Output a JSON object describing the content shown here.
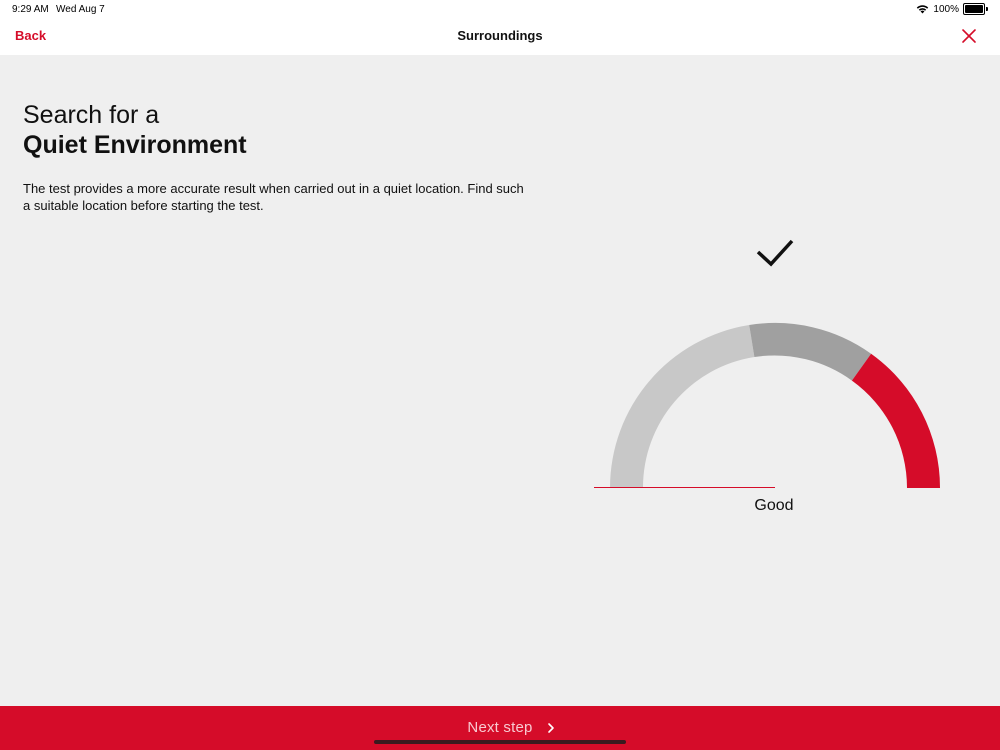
{
  "status_bar": {
    "time": "9:29 AM",
    "date": "Wed Aug 7",
    "battery": "100%",
    "wifi_icon": "wifi-icon",
    "battery_icon": "battery-icon"
  },
  "nav": {
    "back_label": "Back",
    "title": "Surroundings",
    "close_icon": "close-icon"
  },
  "main": {
    "heading_line1": "Search for a",
    "heading_line2": "Quiet Environment",
    "description": "The test provides a more accurate result when carried out in a quiet location. Find such a suitable location before starting the test."
  },
  "gauge": {
    "status_icon": "checkmark-icon",
    "label": "Good",
    "colors": {
      "good": "#c8c8c8",
      "moderate": "#a0a0a0",
      "loud": "#d50c29",
      "needle": "#d50c29"
    },
    "needle_position": "good"
  },
  "footer": {
    "next_label": "Next step",
    "chevron_icon": "chevron-right-icon",
    "color": "#d50c29"
  }
}
